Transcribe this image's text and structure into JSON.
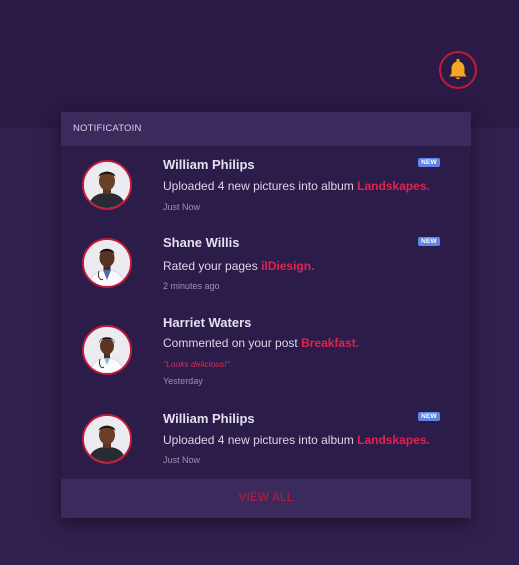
{
  "panel": {
    "header": "NOTIFICATOIN",
    "view_all": "VIEW ALL"
  },
  "bell": {
    "icon": "bell-icon",
    "color": "#f5a623",
    "ring_color": "#c4193c"
  },
  "colors": {
    "accent": "#c4193c",
    "highlight": "#e0234e",
    "badge": "#5f86e6",
    "background": "#31204f"
  },
  "notifications": [
    {
      "name": "William Philips",
      "text": "Uploaded 4 new pictures into album ",
      "highlight": "Landskapes.",
      "time": "Just Now",
      "badge": "NEW"
    },
    {
      "name": "Shane Willis",
      "text": "Rated your pages ",
      "highlight": "ilDiesign.",
      "time": "2 minutes ago",
      "badge": "NEW"
    },
    {
      "name": "Harriet Waters",
      "text": "Commented on your post ",
      "highlight": "Breakfast.",
      "quote": "\"Looks delicious!\"",
      "time": "Yesterday"
    },
    {
      "name": "William Philips",
      "text": "Uploaded 4 new pictures into album ",
      "highlight": "Landskapes.",
      "time": "Just Now",
      "badge": "NEW"
    }
  ]
}
